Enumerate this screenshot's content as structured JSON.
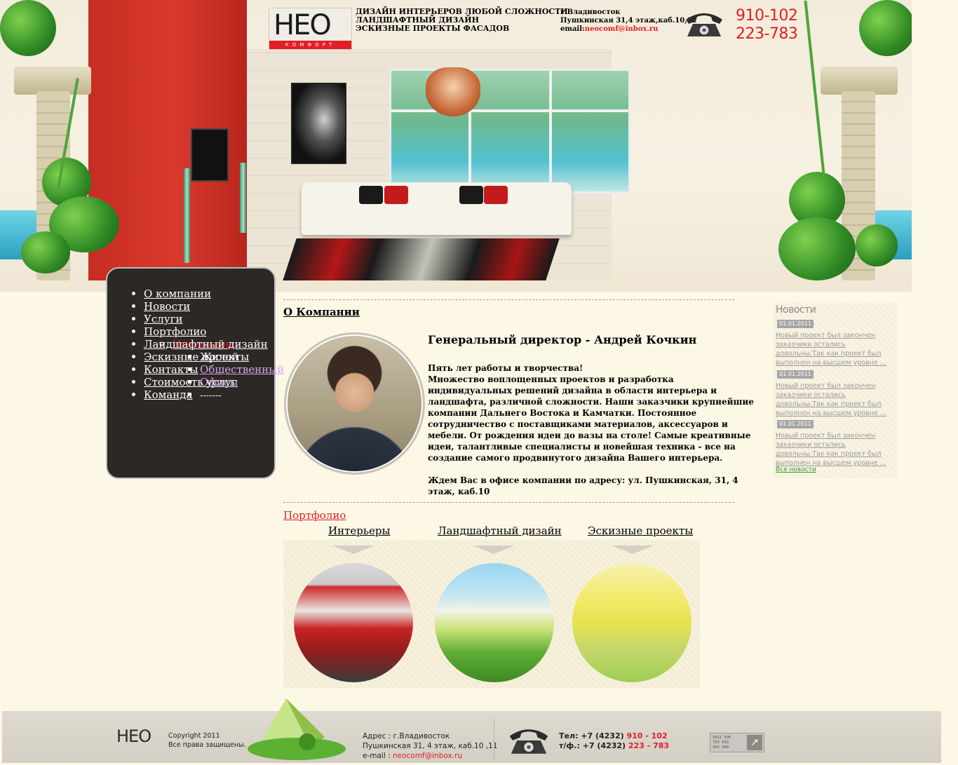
{
  "header": {
    "logo": {
      "word": "НЕО",
      "sub": "КОМФОРТ"
    },
    "slogans": [
      "ДИЗАЙН ИНТЕРЬЕРОВ ЛЮБОЙ СЛОЖНОСТИ",
      "ЛАНДШАФТНЫЙ ДИЗАЙН",
      "ЭСКИЗНЫЕ ПРОЕКТЫ ФАСАДОВ"
    ],
    "city": "г.Владивосток",
    "street": "Пушкинская 31,4 этаж,каб.10,11",
    "email_label": "email:",
    "email": "neocomf@inbox.ru",
    "phone1": "910-102",
    "phone2": "223-783"
  },
  "nav": {
    "items": [
      "О компании",
      "Новости",
      "Услуги",
      "Портфолио"
    ],
    "portfolio_sub": "Интерьеры",
    "interior_sub": [
      "Жилой",
      "Общественный",
      "Офисы",
      "-------"
    ],
    "items_after": [
      "Ландшафтный дизайн",
      "Эскизные проекты",
      "Контакты",
      "Стоимость услуг",
      "Команда"
    ]
  },
  "about": {
    "title": "О Компании",
    "director": "Генеральный директор - Андрей Кочкин",
    "lead": "Пять лет работы и творчества!",
    "body": "Множество воплощенных проектов и разработка индивидуальных решений дизайна в области интерьера и ландшафта, различной сложности. Наши заказчики крупнейшие компании Дальнего Востока и Камчатки. Постоянное сотрудничество с поставщиками материалов, аксессуаров и мебели. От рождения идеи до вазы на столе! Самые креативные идеи, талантливые специалисты и новейшая техника - все на создание самого продвинутого дизайна Вашего интерьера.",
    "address_line": "Ждем Вас в офисе компании по адресу: ул. Пушкинская, 31, 4 этаж, каб.10"
  },
  "portfolio": {
    "title": "Портфолио",
    "categories": [
      "Интерьеры",
      "Ландшафтный дизайн",
      "Эскизные проекты"
    ]
  },
  "news": {
    "title": "Новости",
    "items": [
      {
        "date": "01.01.2011",
        "text": "Новый проект был закончен заказчики остались довольны.Так как проект был выполнен на высшем уровне ..."
      },
      {
        "date": "01.01.2011",
        "text": "Новый проект был закончен заказчики остались довольны.Так как проект был выполнен на высшем уровне ..."
      },
      {
        "date": "01.01.2011",
        "text": "Новый проект был закончен заказчики остались довольны.Так как проект был выполнен на высшем уровне ..."
      }
    ],
    "all_link": "Все новости"
  },
  "footer": {
    "logo_word": "НЕО",
    "copyright": "Copyright 2011",
    "rights": "Все права защищены.",
    "address_label": "Адрес : г.Владивосток",
    "address_line": "Пушкинская 31, 4 этаж, каб.10 ,11",
    "email_label": "e-mail : ",
    "email": "neocomf@inbox.ru",
    "tel_label": "Тел: +7 (4232) ",
    "tel": "910 - 102",
    "fax_label": "т/ф.: +7 (4232) ",
    "fax": "223 - 783",
    "counter_digits": [
      "5021 596",
      "793 692",
      "303 608"
    ],
    "counter_arrow": "↗"
  },
  "colors": {
    "accent_red": "#e31e24",
    "nav_bg": "#2b2826",
    "page_bg": "#fdf8e6",
    "news_green": "#3d9a2a"
  }
}
